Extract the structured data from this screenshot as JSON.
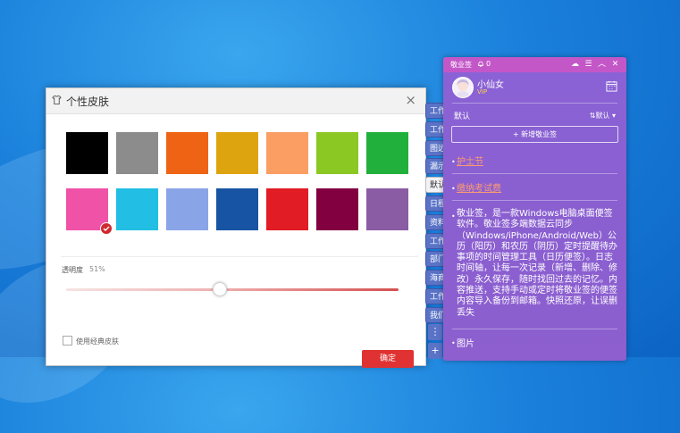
{
  "skin_dialog": {
    "title": "个性皮肤",
    "close": "×",
    "swatches": [
      "#000000",
      "#8c8c8c",
      "#ee6414",
      "#dea410",
      "#fa9e64",
      "#8cc824",
      "#22b03c",
      "#f052a8",
      "#22bee4",
      "#8aa4e8",
      "#1854a4",
      "#e21c24",
      "#820040",
      "#8a5ca4"
    ],
    "selected_index": 7,
    "opacity_label": "透明度",
    "opacity_value": "51%",
    "opacity_level": 0.51,
    "classic_label": "使用经典皮肤",
    "confirm": "确定"
  },
  "side_tabs": [
    "工作",
    "工作",
    "图远",
    "漏示",
    "默认",
    "日程",
    "资料",
    "工作",
    "部门",
    "海商",
    "工作",
    "我们"
  ],
  "side_tab_active": 4,
  "side_buttons": [
    "⋮",
    "+"
  ],
  "note_panel": {
    "title": "敬业签",
    "count": "0",
    "window_buttons": [
      "☁",
      "☰",
      "︿",
      "✕"
    ],
    "user_name": "小仙女",
    "vip": "VIP",
    "category": "默认",
    "sort": "⇅默认 ▾",
    "add_button": "+ 新增敬业签",
    "items": [
      {
        "text": "护士节"
      },
      {
        "text": "缴纳考试费"
      }
    ],
    "body_text": "敬业签，是一款Windows电脑桌面便签软件。敬业签多端数据云同步（Windows/iPhone/Android/Web）公历（阳历）和农历（阴历）定时提醒待办事项的时间管理工具（日历便签）。日志时间轴，让每一次记录（新增、删除、修改）永久保存，随时找回过去的记忆。内容推送，支持手动或定时将敬业签的便签内容导入备份到邮箱。快照还原，让误删丢失",
    "pictures": "图片",
    "accent": "#8a5fd2"
  }
}
